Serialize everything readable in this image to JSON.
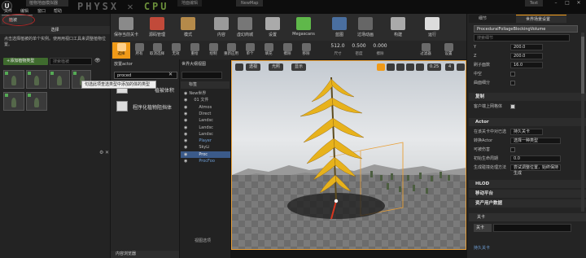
{
  "window": {
    "tab_title": "植物地面模拟器",
    "level_tab": "地面编辑",
    "project_tab": "NewMap",
    "user_tab": "Text",
    "overlay_left": "PHYSX",
    "overlay_right": "CPU"
  },
  "menu": [
    "文件",
    "编辑",
    "窗口",
    "帮助"
  ],
  "modes": {
    "tab_label": "植被",
    "section_title": "选择",
    "description": "点击选择植被的单个实例。使用用视口工具来调整植物位置。",
    "add_button": "+添加植物类型",
    "search_placeholder": "搜索植被"
  },
  "place_actors": {
    "tab_label": "放置actor",
    "search_value": "proced",
    "tooltip": "句选此项查选类型中添加的体的类型",
    "items": [
      {
        "label": "植被体积"
      },
      {
        "label": "程序化植物阻挡体"
      }
    ],
    "content_browser_tab": "内容浏览器"
  },
  "outliner": {
    "tab_label": "世界大纲视图",
    "column_label": "标签",
    "rows": [
      {
        "label": "New世界",
        "style": "normal"
      },
      {
        "label": "01 文件",
        "style": "normal"
      },
      {
        "label": "Atmos",
        "style": "normal"
      },
      {
        "label": "Direct",
        "style": "normal"
      },
      {
        "label": "Landsc",
        "style": "normal"
      },
      {
        "label": "Landsc",
        "style": "normal"
      },
      {
        "label": "Landsc",
        "style": "normal"
      },
      {
        "label": "Player",
        "style": "blue"
      },
      {
        "label": "SkyLi",
        "style": "normal"
      },
      {
        "label": "Proc",
        "style": "selected"
      },
      {
        "label": "ProcFoo",
        "style": "blue"
      }
    ],
    "footer": "视图选项"
  },
  "toolbar": {
    "buttons": [
      {
        "label": "保存当前关卡",
        "icon": "save-icon",
        "color": "#8a8a8a"
      },
      {
        "label": "源码管理",
        "icon": "source-control-icon",
        "color": "#c14a3a"
      },
      {
        "label": "模式",
        "icon": "modes-icon",
        "color": "#b58a4a"
      },
      {
        "label": "内容",
        "icon": "content-icon",
        "color": "#9a9a9a"
      },
      {
        "label": "虚幻商城",
        "icon": "marketplace-icon",
        "color": "#777"
      },
      {
        "label": "设置",
        "icon": "settings-icon",
        "color": "#aaa"
      },
      {
        "label": "Megascans",
        "icon": "megascans-icon",
        "color": "#5fb84a"
      },
      {
        "label": "蓝图",
        "icon": "blueprint-icon",
        "color": "#4a6fa0"
      },
      {
        "label": "过场动画",
        "icon": "cinematics-icon",
        "color": "#666"
      },
      {
        "label": "构建",
        "icon": "build-icon",
        "color": "#aaa"
      },
      {
        "label": "运行",
        "icon": "play-icon",
        "color": "#dcdcdc"
      }
    ]
  },
  "viewport_tools": {
    "tools": [
      {
        "label": "选择",
        "active": true
      },
      {
        "label": "所有",
        "active": false
      },
      {
        "label": "取消选择",
        "active": false
      },
      {
        "label": "无效",
        "active": false
      },
      {
        "label": "重绘",
        "active": false
      },
      {
        "label": "绘制",
        "active": false
      },
      {
        "label": "重新应用",
        "active": false
      },
      {
        "label": "单个",
        "active": false
      },
      {
        "label": "填充",
        "active": false
      },
      {
        "label": "擦除",
        "active": false
      },
      {
        "label": "移除",
        "active": false
      }
    ],
    "numbers": [
      {
        "value": "512.0",
        "label": "尺寸"
      },
      {
        "value": "0.500",
        "label": "密度"
      },
      {
        "value": "0.000",
        "label": "擦除"
      }
    ],
    "right_tools": [
      {
        "label": "过滤器"
      },
      {
        "label": "设置"
      }
    ]
  },
  "viewport": {
    "perspective_label": "透视",
    "lit_label": "光照",
    "show_label": "显示",
    "snap_value": "0.25",
    "snap_count": "4"
  },
  "details": {
    "tab1": "细节",
    "tab2": "世界场景设置",
    "actor_name": "ProceduralFoliageBlockingVolume",
    "search_placeholder": "搜索细节",
    "transform_rows": [
      {
        "label": "Y",
        "value": "200.0"
      },
      {
        "label": "Z",
        "value": "200.0"
      },
      {
        "label": "刷子面数",
        "value": "16.0"
      },
      {
        "label": "中空",
        "value": ""
      },
      {
        "label": "曲面细分",
        "value": ""
      }
    ],
    "sections": {
      "duplicate": "复制",
      "actor": "Actor",
      "hlod": "HLOD",
      "mobile": "移动平台",
      "asset_user_data": "资产用户数据"
    },
    "duplicate_row": "客户端上网格体",
    "actor_rows": [
      {
        "label": "在该关卡中对已选",
        "value": "持久关卡"
      },
      {
        "label": "转换Actor",
        "value": "选择一种类型"
      },
      {
        "label": "可被伤害",
        "value": ""
      },
      {
        "label": "初始生命周期",
        "value": "0.0"
      },
      {
        "label": "生成碰撞处理方法",
        "value": "尝试调整位置，始终保持生成"
      }
    ],
    "bottom_tab": "关卡",
    "bottom_combo": "关卡",
    "bottom_item": "持久关卡"
  },
  "colors": {
    "accent": "#f09a18",
    "selection": "#3b5a89",
    "panel": "#242424",
    "foliage": "#e7b21c"
  }
}
